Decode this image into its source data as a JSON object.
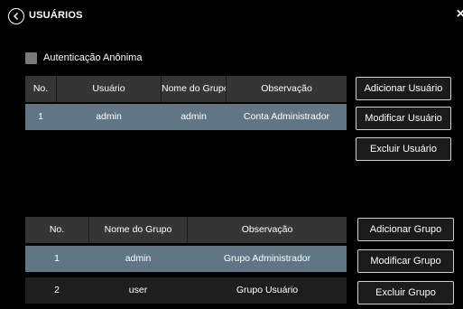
{
  "header": {
    "title": "USUÁRIOS"
  },
  "anonymous_auth": {
    "label": "Autenticação Anônima",
    "checked": false
  },
  "users_table": {
    "columns": [
      "No.",
      "Usuário",
      "Nome do Grupo",
      "Observação"
    ],
    "rows": [
      {
        "no": "1",
        "user": "admin",
        "group": "admin",
        "note": "Conta Administrador"
      }
    ]
  },
  "user_buttons": {
    "add": "Adicionar Usuário",
    "modify": "Modificar Usuário",
    "delete": "Excluir Usuário"
  },
  "groups_table": {
    "columns": [
      "No.",
      "Nome do Grupo",
      "Observação"
    ],
    "rows": [
      {
        "no": "1",
        "group": "admin",
        "note": "Grupo Administrador"
      },
      {
        "no": "2",
        "group": "user",
        "note": "Grupo Usuário"
      }
    ]
  },
  "group_buttons": {
    "add": "Adicionar Grupo",
    "modify": "Modificar Grupo",
    "delete": "Excluir Grupo"
  },
  "colors": {
    "background": "#000000",
    "header_row": "#353535",
    "selected_row": "#617685",
    "button_border": "#d0d0d0"
  }
}
